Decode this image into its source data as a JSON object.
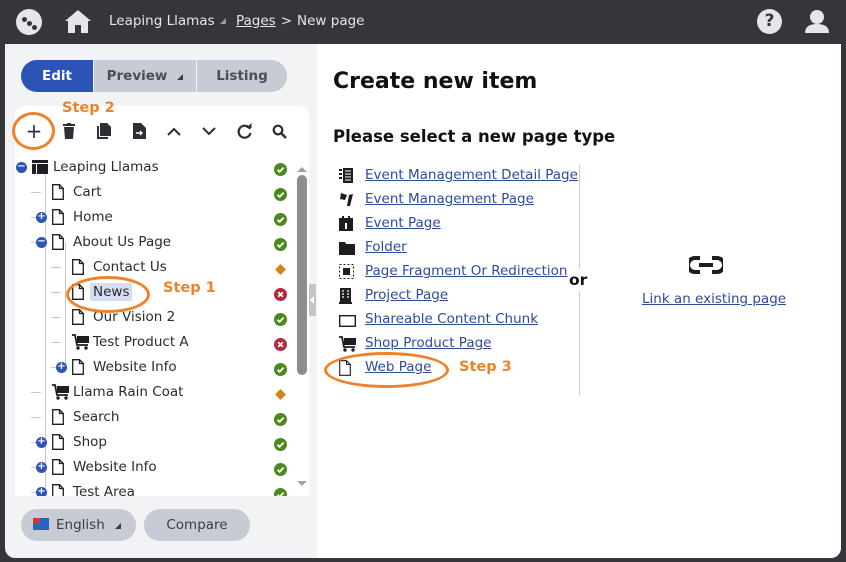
{
  "topbar": {
    "site_name": "Leaping Llamas",
    "breadcrumb": {
      "link": "Pages",
      "separator": ">",
      "current": "New page"
    },
    "icons": [
      "app-logo-icon",
      "home-icon",
      "help-icon",
      "user-icon"
    ],
    "help_glyph": "?"
  },
  "left": {
    "modes": {
      "edit": "Edit",
      "preview": "Preview",
      "listing": "Listing",
      "active": "Edit"
    },
    "toolbar": [
      "add",
      "delete",
      "copy",
      "move",
      "move-up",
      "move-down",
      "refresh",
      "search"
    ],
    "toolbar_glyphs": {
      "add": "+",
      "up": "⌃",
      "down": "⌄",
      "refresh": "↻"
    },
    "tree": [
      {
        "label": "Leaping Llamas",
        "level": 0,
        "toggle": "−",
        "icon": "site",
        "status": "published"
      },
      {
        "label": "Cart",
        "level": 1,
        "toggle": "",
        "icon": "page",
        "status": "published"
      },
      {
        "label": "Home",
        "level": 1,
        "toggle": "+",
        "icon": "page",
        "status": "published"
      },
      {
        "label": "About Us Page",
        "level": 1,
        "toggle": "−",
        "icon": "page",
        "status": "published"
      },
      {
        "label": "Contact Us",
        "level": 2,
        "toggle": "",
        "icon": "page",
        "status": "draft"
      },
      {
        "label": "News",
        "level": 2,
        "toggle": "",
        "icon": "page",
        "status": "unpublished",
        "selected": true
      },
      {
        "label": "Our Vision 2",
        "level": 2,
        "toggle": "",
        "icon": "page",
        "status": "published"
      },
      {
        "label": "Test Product A",
        "level": 2,
        "toggle": "",
        "icon": "product",
        "status": "unpublished"
      },
      {
        "label": "Website Info",
        "level": 2,
        "toggle": "+",
        "icon": "page",
        "status": "published"
      },
      {
        "label": "Llama Rain Coat",
        "level": 1,
        "toggle": "",
        "icon": "product",
        "status": "draft"
      },
      {
        "label": "Search",
        "level": 1,
        "toggle": "",
        "icon": "page",
        "status": "published"
      },
      {
        "label": "Shop",
        "level": 1,
        "toggle": "+",
        "icon": "page",
        "status": "published"
      },
      {
        "label": "Website Info",
        "level": 1,
        "toggle": "+",
        "icon": "page",
        "status": "published"
      },
      {
        "label": "Test Area",
        "level": 1,
        "toggle": "+",
        "icon": "page",
        "status": "published"
      }
    ],
    "bottom": {
      "language": "English",
      "compare": "Compare"
    }
  },
  "main": {
    "title": "Create new item",
    "subtitle": "Please select a new page type",
    "page_types": [
      {
        "label": "Event Management Detail Page",
        "icon": "event-detail-icon"
      },
      {
        "label": "Event Management Page",
        "icon": "event-management-icon"
      },
      {
        "label": "Event Page",
        "icon": "calendar-icon"
      },
      {
        "label": "Folder",
        "icon": "folder-icon"
      },
      {
        "label": "Page Fragment Or Redirection",
        "icon": "fragment-icon"
      },
      {
        "label": "Project Page",
        "icon": "building-icon"
      },
      {
        "label": "Shareable Content Chunk",
        "icon": "chunk-icon"
      },
      {
        "label": "Shop Product Page",
        "icon": "cart-icon"
      },
      {
        "label": "Web Page",
        "icon": "page-icon"
      }
    ],
    "or_label": "or",
    "link_existing": "Link an existing page"
  },
  "annotations": {
    "step1": "Step 1",
    "step2": "Step 2",
    "step3": "Step 3"
  },
  "colors": {
    "accent": "#2c53b6",
    "annotation": "#ef8229",
    "status_published": "#4a8a1c",
    "status_unpublished": "#b5283a",
    "status_draft": "#d0861a",
    "link": "#2f4a99"
  }
}
